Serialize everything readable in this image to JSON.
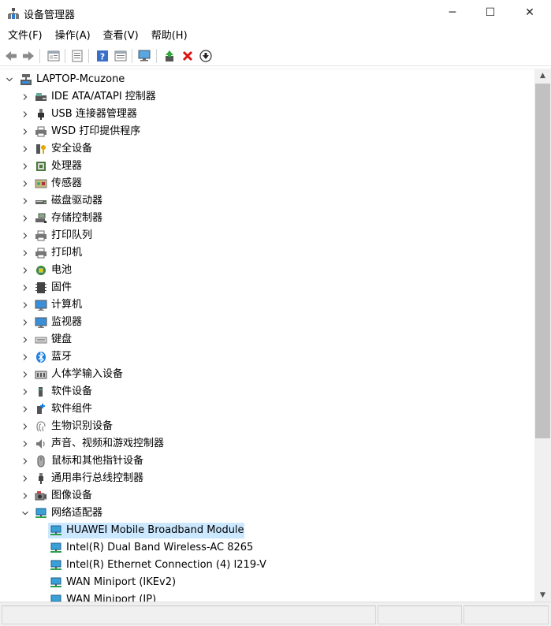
{
  "window": {
    "title": "设备管理器",
    "minimize_glyph": "─",
    "maximize_glyph": "☐",
    "close_glyph": "✕"
  },
  "menu": [
    "文件(F)",
    "操作(A)",
    "查看(V)",
    "帮助(H)"
  ],
  "toolbar": [
    "back-icon",
    "forward-icon",
    "properties-icon",
    "show-hide-icon",
    "help-icon",
    "view-icon",
    "scan-icon",
    "update-driver-icon",
    "uninstall-icon",
    "disable-icon"
  ],
  "tree": {
    "root": "LAPTOP-Mcuzone",
    "categories": [
      {
        "label": "IDE ATA/ATAPI 控制器",
        "icon": "ide-controller-icon"
      },
      {
        "label": "USB 连接器管理器",
        "icon": "usb-connector-icon"
      },
      {
        "label": "WSD 打印提供程序",
        "icon": "printer-icon"
      },
      {
        "label": "安全设备",
        "icon": "security-device-icon"
      },
      {
        "label": "处理器",
        "icon": "processor-icon"
      },
      {
        "label": "传感器",
        "icon": "sensor-icon"
      },
      {
        "label": "磁盘驱动器",
        "icon": "disk-drive-icon"
      },
      {
        "label": "存储控制器",
        "icon": "storage-controller-icon"
      },
      {
        "label": "打印队列",
        "icon": "print-queue-icon"
      },
      {
        "label": "打印机",
        "icon": "printer-icon"
      },
      {
        "label": "电池",
        "icon": "battery-icon"
      },
      {
        "label": "固件",
        "icon": "firmware-icon"
      },
      {
        "label": "计算机",
        "icon": "computer-icon"
      },
      {
        "label": "监视器",
        "icon": "monitor-icon"
      },
      {
        "label": "键盘",
        "icon": "keyboard-icon"
      },
      {
        "label": "蓝牙",
        "icon": "bluetooth-icon"
      },
      {
        "label": "人体学输入设备",
        "icon": "hid-icon"
      },
      {
        "label": "软件设备",
        "icon": "software-device-icon"
      },
      {
        "label": "软件组件",
        "icon": "software-component-icon"
      },
      {
        "label": "生物识别设备",
        "icon": "biometric-icon"
      },
      {
        "label": "声音、视频和游戏控制器",
        "icon": "sound-icon"
      },
      {
        "label": "鼠标和其他指针设备",
        "icon": "mouse-icon"
      },
      {
        "label": "通用串行总线控制器",
        "icon": "usb-icon"
      },
      {
        "label": "图像设备",
        "icon": "camera-icon"
      },
      {
        "label": "网络适配器",
        "icon": "network-adapter-icon",
        "expanded": true
      }
    ],
    "network_children": [
      {
        "label": "HUAWEI Mobile Broadband Module",
        "selected": true
      },
      {
        "label": "Intel(R) Dual Band Wireless-AC 8265"
      },
      {
        "label": "Intel(R) Ethernet Connection (4) I219-V"
      },
      {
        "label": "WAN Miniport (IKEv2)"
      },
      {
        "label": "WAN Miniport (IP)"
      }
    ]
  },
  "colors": {
    "selection": "#cce8ff",
    "scroll_thumb": "#c1c1c1",
    "network_icon": "#1e8bd1"
  }
}
